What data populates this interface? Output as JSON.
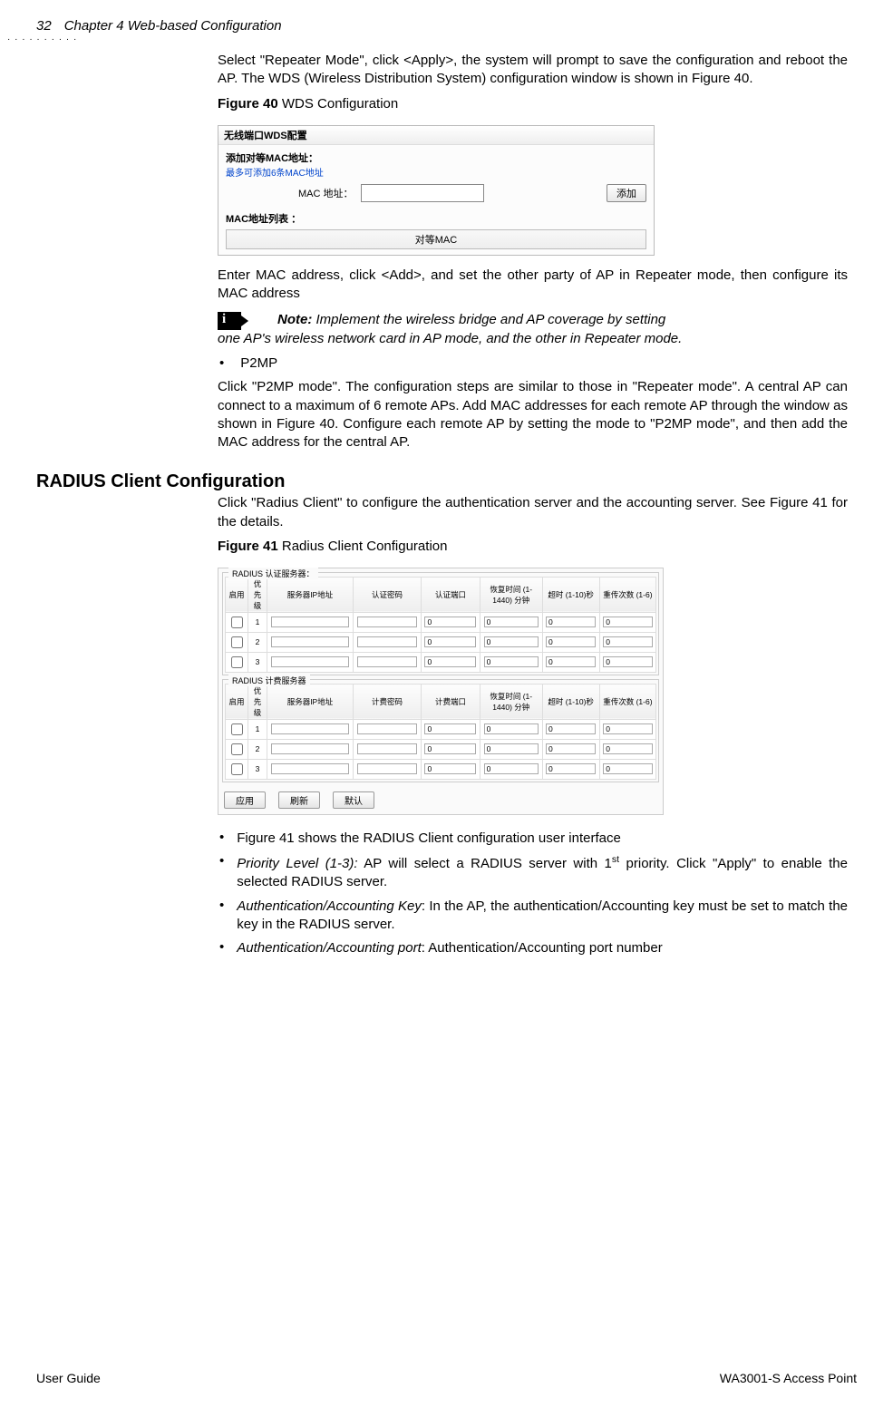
{
  "header": {
    "page_number": "32",
    "chapter_title": "Chapter 4 Web-based Configuration"
  },
  "p1": "Select \"Repeater Mode\", click <Apply>, the system will prompt to save the configuration and reboot the AP. The WDS (Wireless Distribution System) configuration window is shown in Figure 40.",
  "fig40_label": "Figure 40",
  "fig40_caption": " WDS Configuration",
  "fig40": {
    "title": "无线端口WDS配置",
    "line1": "添加对等MAC地址：",
    "line2": "最多可添加6条MAC地址",
    "mac_label": "MAC 地址：",
    "add_btn": "添加",
    "list_label": "MAC地址列表 ：",
    "col_header": "对等MAC"
  },
  "p2": "Enter MAC address, click <Add>, and set the other party of AP in Repeater mode, then configure its MAC address",
  "note_label": "Note:",
  "note_line1": " Implement the wireless bridge and AP coverage by setting",
  "note_rest": "one AP's wireless network card in AP mode, and the other in Repeater mode.",
  "bullet_p2mp": "P2MP",
  "p3": "Click \"P2MP mode\". The configuration steps are similar to those in \"Repeater mode\". A central AP can connect to a maximum of 6 remote APs. Add MAC addresses for each remote AP through the window as shown in Figure 40. Configure each remote AP by setting the mode to \"P2MP mode\", and then add the MAC address for the central AP.",
  "sec_heading": "RADIUS Client Configuration",
  "p4": "Click \"Radius Client\" to configure the authentication server and the accounting server. See Figure 41 for the details.",
  "fig41_label": "Figure 41",
  "fig41_caption": " Radius Client Configuration",
  "fig41": {
    "group1_legend": "RADIUS 认证服务器：",
    "group2_legend": "RADIUS 计费服务器",
    "cols_auth": [
      "启用",
      "优先级",
      "服务器IP地址",
      "认证密码",
      "认证端口",
      "恢复时间 (1-1440) 分钟",
      "超时 (1-10)秒",
      "重传次数 (1-6)"
    ],
    "cols_acct": [
      "启用",
      "优先级",
      "服务器IP地址",
      "计费密码",
      "计费端口",
      "恢复时间 (1-1440) 分钟",
      "超时 (1-10)秒",
      "重传次数 (1-6)"
    ],
    "rows": [
      "1",
      "2",
      "3"
    ],
    "zero": "0",
    "btn_apply": "应用",
    "btn_refresh": "刷新",
    "btn_default": "默认"
  },
  "bullets": {
    "b1": "Figure 41 shows the RADIUS Client configuration user interface",
    "b2_label": "Priority Level (1-3):",
    "b2_rest_a": " AP will select a RADIUS server with 1",
    "b2_sup": "st",
    "b2_rest_b": " priority. Click \"Apply\" to enable the selected RADIUS server.",
    "b3_label": "Authentication/Accounting Key",
    "b3_rest": ": In the AP, the authentication/Accounting key must be set to match the key in the RADIUS server.",
    "b4_label": "Authentication/Accounting port",
    "b4_rest": ": Authentication/Accounting port number"
  },
  "footer": {
    "left": "User Guide",
    "right": "WA3001-S Access Point"
  }
}
